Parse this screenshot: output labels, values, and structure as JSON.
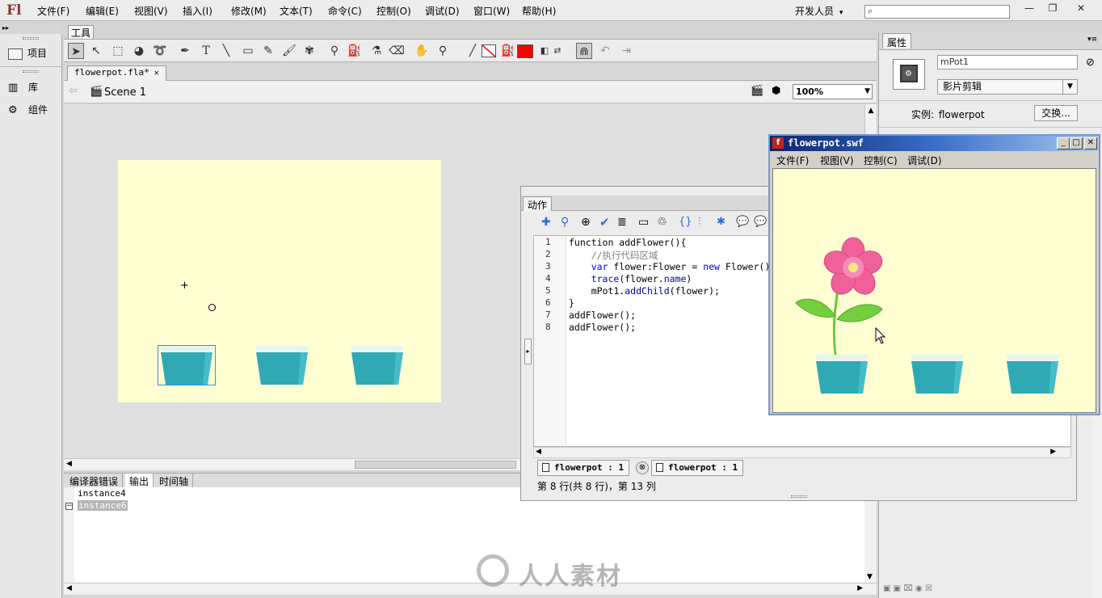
{
  "app": {
    "logo": "Fl"
  },
  "menu": [
    "文件(F)",
    "编辑(E)",
    "视图(V)",
    "插入(I)",
    "修改(M)",
    "文本(T)",
    "命令(C)",
    "控制(O)",
    "调试(D)",
    "窗口(W)",
    "帮助(H)"
  ],
  "workspace": {
    "label": "开发人员",
    "arrow": "▾"
  },
  "search": {
    "placeholder": ""
  },
  "window_controls": {
    "min": "—",
    "restore": "❐",
    "close": "✕"
  },
  "left_panel": {
    "project": "项目",
    "library": "库",
    "components": "组件"
  },
  "tools_panel": {
    "title": "工具"
  },
  "document": {
    "tab": "flowerpot.fla*",
    "close": "✕",
    "scene": "Scene 1",
    "zoom": "100%"
  },
  "output_panel": {
    "tabs": [
      "编译器错误",
      "输出",
      "时间轴"
    ],
    "active_tab": 1,
    "lines": [
      "instance4",
      "instance6"
    ]
  },
  "properties": {
    "title": "属性",
    "instance_name": "mPot1",
    "symbol_type": "影片剪辑",
    "instance_label": "实例:",
    "instance_of": "flowerpot",
    "swap_button": "交换..."
  },
  "actions_panel": {
    "title": "动作",
    "line_numbers": [
      "1",
      "2",
      "3",
      "4",
      "5",
      "6",
      "7",
      "8"
    ],
    "code": [
      [
        {
          "t": "function addFlower(){",
          "c": ""
        }
      ],
      [
        {
          "t": "    //执行代码区域",
          "c": "cm"
        }
      ],
      [
        {
          "t": "    ",
          "c": ""
        },
        {
          "t": "var",
          "c": "kw"
        },
        {
          "t": " flower:Flower = ",
          "c": ""
        },
        {
          "t": "new",
          "c": "kw"
        },
        {
          "t": " Flower()",
          "c": ""
        }
      ],
      [
        {
          "t": "    ",
          "c": ""
        },
        {
          "t": "trace",
          "c": "fn"
        },
        {
          "t": "(flower.",
          "c": ""
        },
        {
          "t": "name",
          "c": "fn"
        },
        {
          "t": ")",
          "c": ""
        }
      ],
      [
        {
          "t": "    mPot1.",
          "c": ""
        },
        {
          "t": "addChild",
          "c": "fn"
        },
        {
          "t": "(flower);",
          "c": ""
        }
      ],
      [
        {
          "t": "}",
          "c": ""
        }
      ],
      [
        {
          "t": "addFlower();",
          "c": ""
        }
      ],
      [
        {
          "t": "addFlower();",
          "c": ""
        }
      ]
    ],
    "script_tabs": [
      "flowerpot : 1",
      "flowerpot : 1"
    ],
    "status": "第 8 行(共 8 行)，第 13 列"
  },
  "swf_window": {
    "title": "flowerpot.swf",
    "menu": [
      "文件(F)",
      "视图(V)",
      "控制(C)",
      "调试(D)"
    ]
  },
  "watermark": "人人素材",
  "colors": {
    "stage": "#ffffd2",
    "pot": "#2fa9b4",
    "flower": "#f0609a",
    "leaf": "#6cc83c",
    "fill_swatch": "#ff0000"
  }
}
